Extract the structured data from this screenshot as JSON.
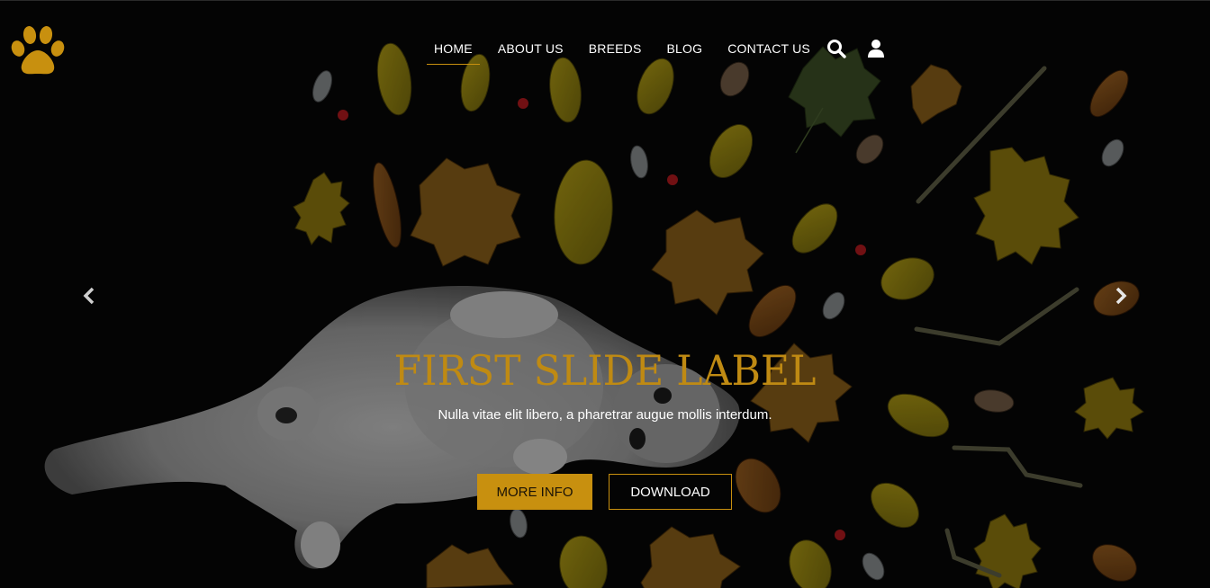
{
  "brand": {
    "logo_icon": "paw-icon",
    "accent_color": "#c8900f"
  },
  "nav": {
    "items": [
      {
        "label": "HOME",
        "active": true
      },
      {
        "label": "ABOUT US",
        "active": false
      },
      {
        "label": "BREEDS",
        "active": false
      },
      {
        "label": "BLOG",
        "active": false
      },
      {
        "label": "CONTACT US",
        "active": false
      }
    ],
    "icons": [
      "search-icon",
      "user-icon"
    ]
  },
  "carousel": {
    "prev_icon": "chevron-left-icon",
    "next_icon": "chevron-right-icon",
    "slide": {
      "title": "FIRST SLIDE LABEL",
      "text": "Nulla vitae elit libero, a pharetrar augue mollis interdum.",
      "buttons": {
        "primary": "MORE INFO",
        "secondary": "DOWNLOAD"
      }
    }
  }
}
